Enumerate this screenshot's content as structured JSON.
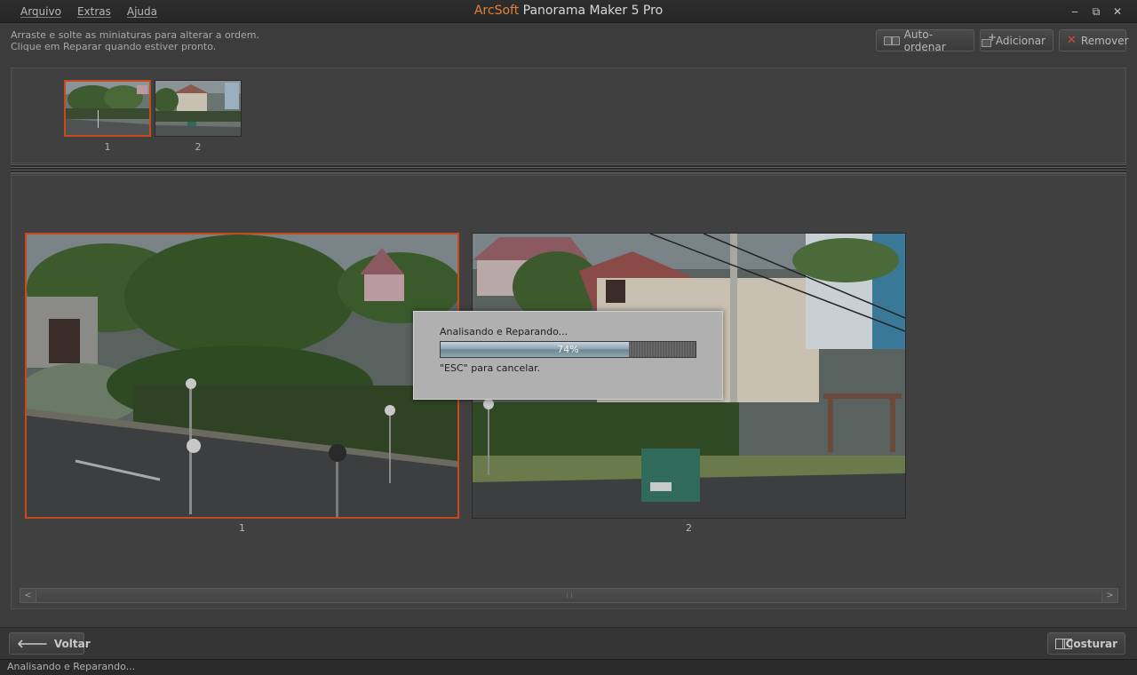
{
  "window": {
    "brand": "ArcSoft",
    "title_rest": " Panorama Maker 5 Pro",
    "menu": [
      "Arquivo",
      "Extras",
      "Ajuda"
    ],
    "controls": {
      "minimize": "‒",
      "restore": "⧉",
      "close": "✕"
    }
  },
  "instructions": {
    "line1": "Arraste e solte as miniaturas para alterar a ordem.",
    "line2": "Clique em Reparar quando estiver pronto."
  },
  "toolbar": {
    "auto_order": "Auto-ordenar",
    "add": "Adicionar",
    "remove": "Remover"
  },
  "thumbnails": [
    {
      "label": "1",
      "selected": true
    },
    {
      "label": "2",
      "selected": false
    }
  ],
  "photos": [
    {
      "label": "1",
      "selected": true
    },
    {
      "label": "2",
      "selected": false
    }
  ],
  "dialog": {
    "message": "Analisando e Reparando...",
    "progress_percent": 74,
    "progress_text": "74%",
    "cancel_hint": "\"ESC\" para cancelar."
  },
  "scrollbar": {
    "left": "<",
    "right": ">"
  },
  "bottom": {
    "back": "Voltar",
    "stitch": "Costurar"
  },
  "status": "Analisando e Reparando...",
  "colors": {
    "accent": "#c84a18",
    "brand": "#e0803a",
    "close": "#d24a3a"
  }
}
